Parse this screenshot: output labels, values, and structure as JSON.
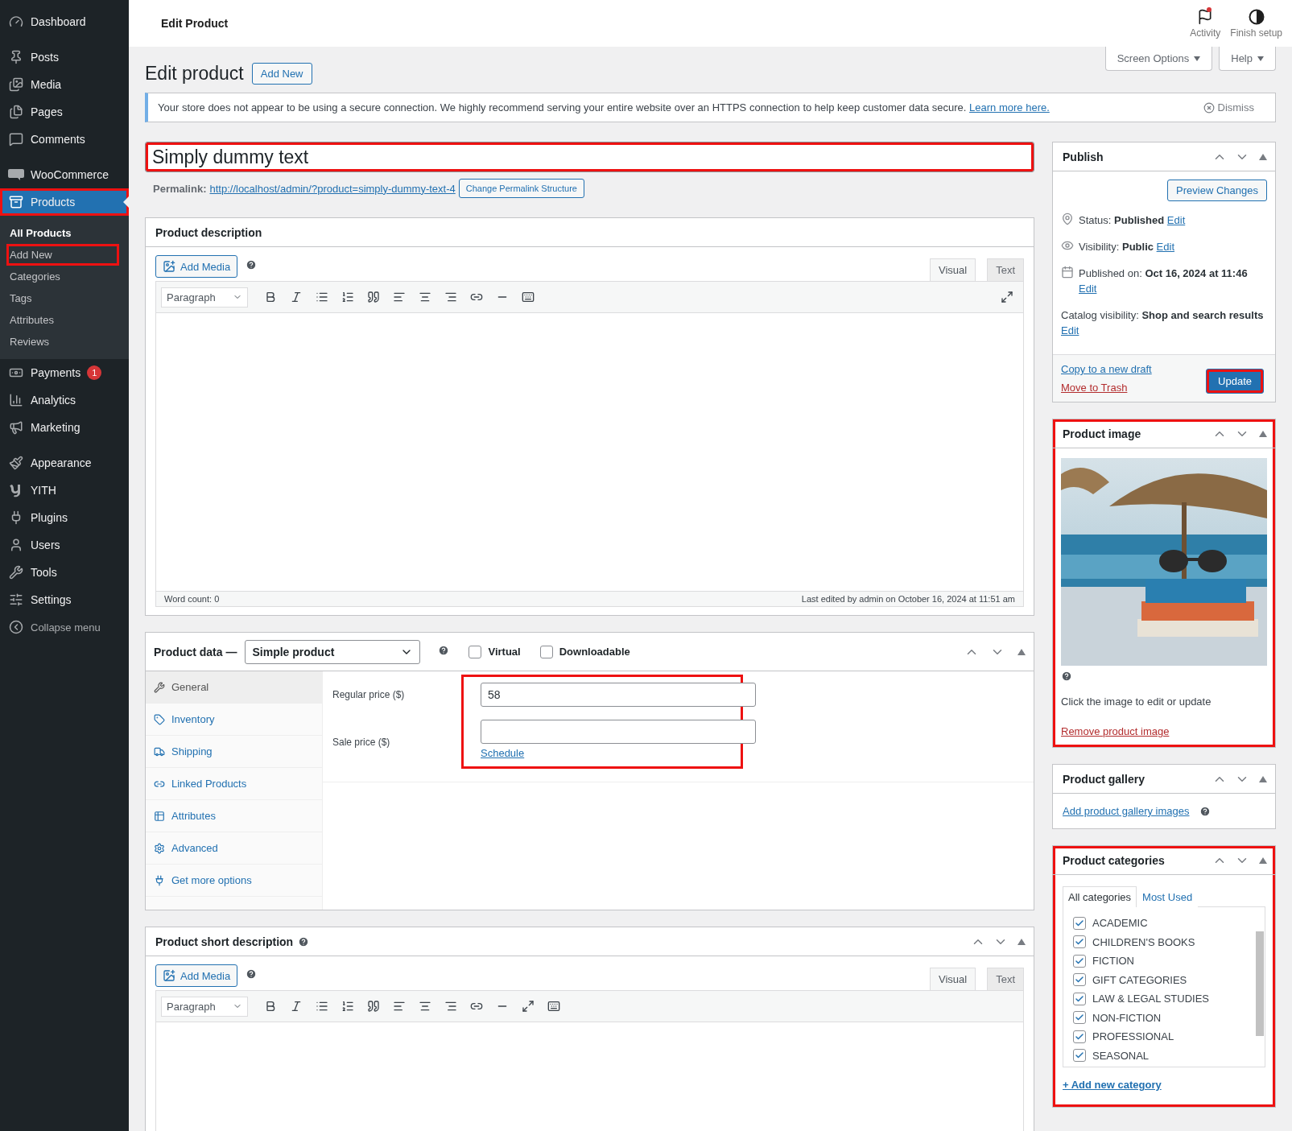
{
  "sidebar": {
    "groups": [
      {
        "items": [
          {
            "kind": "dashboard",
            "label": "Dashboard",
            "selected": false,
            "highlighted": false
          }
        ]
      },
      {
        "items": [
          {
            "kind": "posts",
            "label": "Posts",
            "selected": false,
            "highlighted": false
          },
          {
            "kind": "media",
            "label": "Media",
            "selected": false,
            "highlighted": false
          },
          {
            "kind": "pages",
            "label": "Pages",
            "selected": false,
            "highlighted": false
          },
          {
            "kind": "comments",
            "label": "Comments",
            "selected": false,
            "highlighted": false
          }
        ]
      },
      {
        "items": [
          {
            "kind": "woocommerce",
            "label": "WooCommerce",
            "selected": false,
            "highlighted": false
          },
          {
            "kind": "products",
            "label": "Products",
            "selected": true,
            "highlighted": true,
            "children": [
              {
                "label": "All Products",
                "selected": true,
                "highlighted": false
              },
              {
                "label": "Add New",
                "selected": false,
                "highlighted": true
              },
              {
                "label": "Categories",
                "selected": false,
                "highlighted": false
              },
              {
                "label": "Tags",
                "selected": false,
                "highlighted": false
              },
              {
                "label": "Attributes",
                "selected": false,
                "highlighted": false
              },
              {
                "label": "Reviews",
                "selected": false,
                "highlighted": false
              }
            ]
          },
          {
            "kind": "payments",
            "label": "Payments",
            "badge": "1",
            "selected": false,
            "highlighted": false
          },
          {
            "kind": "analytics",
            "label": "Analytics",
            "selected": false,
            "highlighted": false
          },
          {
            "kind": "marketing",
            "label": "Marketing",
            "selected": false,
            "highlighted": false
          }
        ]
      },
      {
        "items": [
          {
            "kind": "appearance",
            "label": "Appearance",
            "selected": false,
            "highlighted": false
          },
          {
            "kind": "yith",
            "label": "YITH",
            "selected": false,
            "highlighted": false
          },
          {
            "kind": "plugins",
            "label": "Plugins",
            "selected": false,
            "highlighted": false
          },
          {
            "kind": "users",
            "label": "Users",
            "selected": false,
            "highlighted": false
          },
          {
            "kind": "tools",
            "label": "Tools",
            "selected": false,
            "highlighted": false
          },
          {
            "kind": "settings",
            "label": "Settings",
            "selected": false,
            "highlighted": false
          },
          {
            "kind": "collapse",
            "label": "Collapse menu",
            "selected": false,
            "highlighted": false
          }
        ]
      }
    ]
  },
  "topbar": {
    "title": "Edit Product",
    "actions": [
      {
        "kind": "activity",
        "label": "Activity",
        "notification": true
      },
      {
        "kind": "setup",
        "label": "Finish setup",
        "notification": false
      }
    ]
  },
  "screen_tabs": [
    "Screen Options",
    "Help"
  ],
  "heading": {
    "title": "Edit product",
    "button": "Add New"
  },
  "notice": {
    "text": "Your store does not appear to be using a secure connection. We highly recommend serving your entire website over an HTTPS connection to help keep customer data secure.",
    "link": "Learn more here.",
    "dismiss": "Dismiss"
  },
  "title_field": {
    "value": "Simply dummy text",
    "highlighted": true
  },
  "permalink": {
    "label": "Permalink:",
    "url": "http://localhost/admin/?product=simply-dummy-text-4",
    "button": "Change Permalink Structure"
  },
  "description": {
    "title": "Product description",
    "add_media": "Add Media",
    "tabs": [
      {
        "label": "Visual",
        "selected": true
      },
      {
        "label": "Text",
        "selected": false
      }
    ],
    "format": "Paragraph",
    "word_count": "Word count: 0",
    "last_edited": "Last edited by admin on October 16, 2024 at 11:51 am"
  },
  "product_data": {
    "title": "Product data —",
    "type": "Simple product",
    "options": [
      {
        "label": "Virtual",
        "checked": false
      },
      {
        "label": "Downloadable",
        "checked": false
      }
    ],
    "tabs": [
      {
        "kind": "general",
        "label": "General",
        "selected": true
      },
      {
        "kind": "inventory",
        "label": "Inventory",
        "selected": false
      },
      {
        "kind": "shipping",
        "label": "Shipping",
        "selected": false
      },
      {
        "kind": "linked",
        "label": "Linked Products",
        "selected": false
      },
      {
        "kind": "attributes",
        "label": "Attributes",
        "selected": false
      },
      {
        "kind": "advanced",
        "label": "Advanced",
        "selected": false
      },
      {
        "kind": "more",
        "label": "Get more options",
        "selected": false
      }
    ],
    "fields": [
      {
        "label": "Regular price ($)",
        "value": "58"
      },
      {
        "label": "Sale price ($)"
      }
    ],
    "schedule": "Schedule",
    "highlighted": true
  },
  "short_description": {
    "title": "Product short description",
    "add_media": "Add Media",
    "tabs": [
      {
        "label": "Visual",
        "selected": true
      },
      {
        "label": "Text",
        "selected": false
      }
    ],
    "format": "Paragraph"
  },
  "publish": {
    "title": "Publish",
    "preview": "Preview Changes",
    "rows": [
      {
        "kind": "status",
        "label": "Status:",
        "value": "Published",
        "link": "Edit"
      },
      {
        "kind": "visibility",
        "label": "Visibility:",
        "value": "Public",
        "link": "Edit"
      },
      {
        "kind": "date",
        "label": "Published on:",
        "value": "Oct 16, 2024 at 11:46",
        "link": "Edit"
      },
      {
        "kind": "catalog",
        "label": "Catalog visibility:",
        "value": "Shop and search results",
        "link": "Edit"
      }
    ],
    "copy_link": "Copy to a new draft",
    "trash_link": "Move to Trash",
    "update": "Update",
    "update_highlighted": true
  },
  "product_image": {
    "title": "Product image",
    "hint": "Click the image to edit or update",
    "remove": "Remove product image",
    "highlighted": true
  },
  "gallery": {
    "title": "Product gallery",
    "link": "Add product gallery images"
  },
  "categories": {
    "title": "Product categories",
    "highlighted": true,
    "tabs": [
      {
        "label": "All categories",
        "selected": true
      },
      {
        "label": "Most Used",
        "selected": false
      }
    ],
    "items": [
      {
        "label": "ACADEMIC",
        "checked": true
      },
      {
        "label": "CHILDREN'S BOOKS",
        "checked": true
      },
      {
        "label": "FICTION",
        "checked": true
      },
      {
        "label": "GIFT CATEGORIES",
        "checked": true
      },
      {
        "label": "LAW & LEGAL STUDIES",
        "checked": true
      },
      {
        "label": "NON-FICTION",
        "checked": true
      },
      {
        "label": "PROFESSIONAL",
        "checked": true
      },
      {
        "label": "SEASONAL",
        "checked": true
      }
    ],
    "add": "+ Add new category"
  }
}
